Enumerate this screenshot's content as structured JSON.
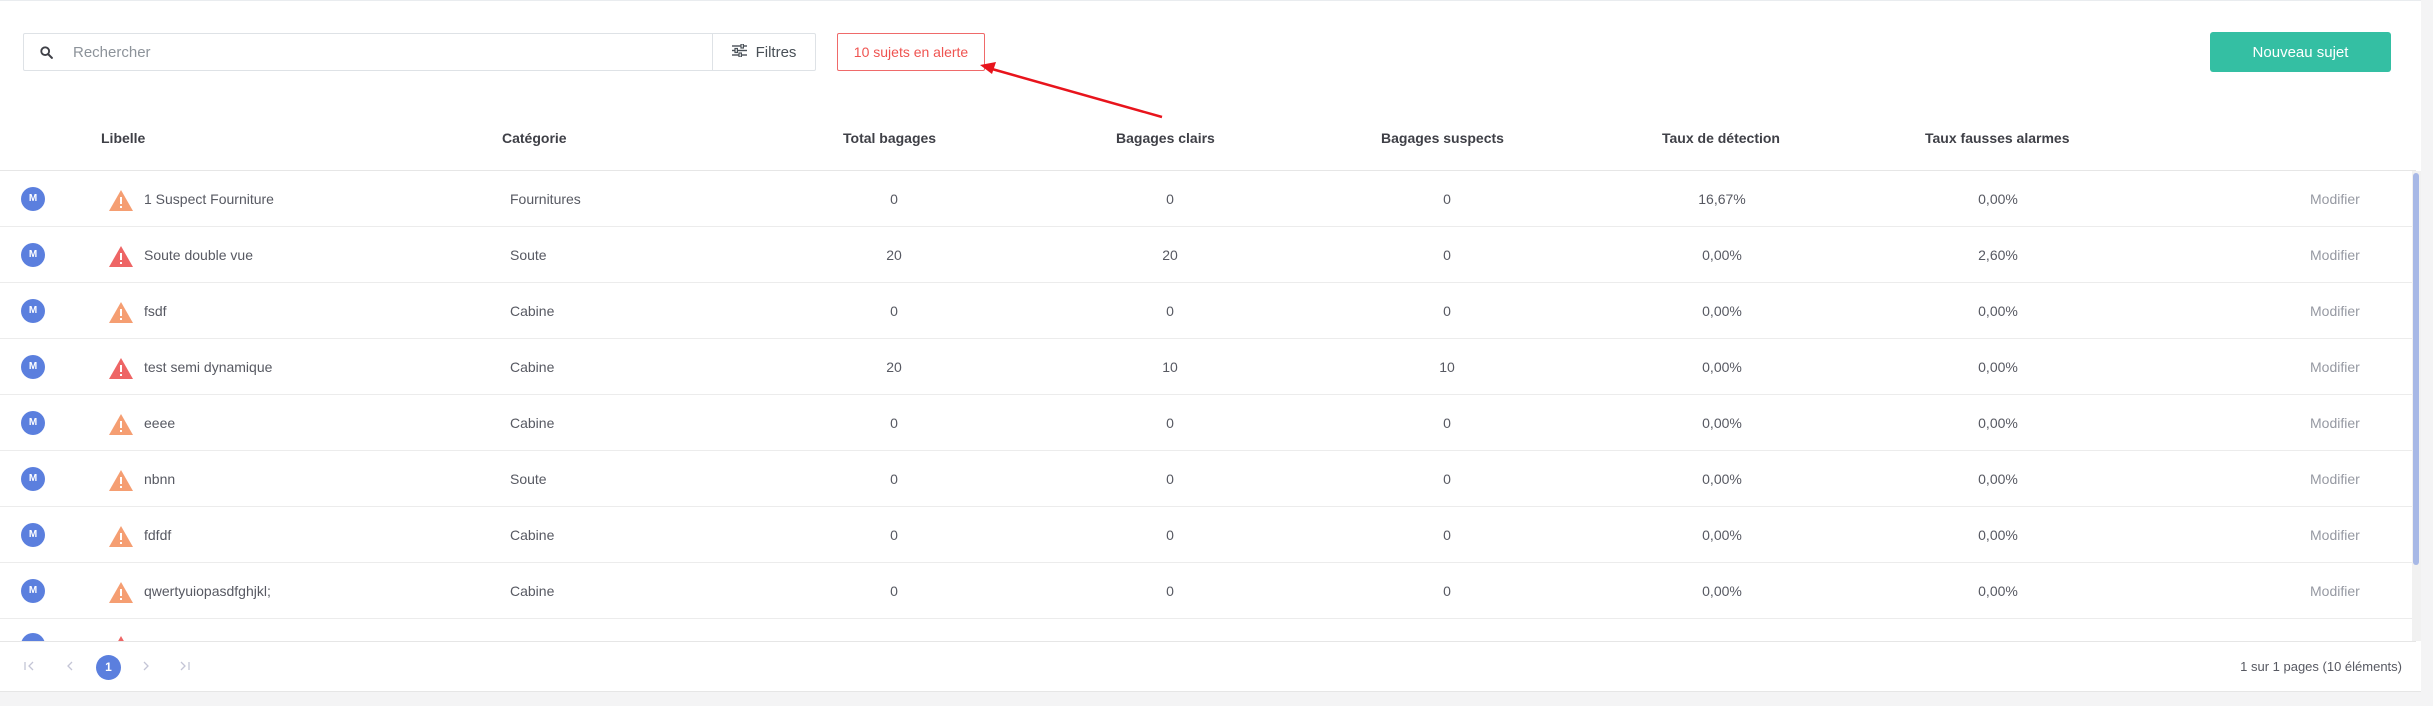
{
  "toolbar": {
    "search_placeholder": "Rechercher",
    "search_value": "",
    "filter_label": "Filtres",
    "alert_label": "10 sujets en alerte",
    "new_subject_label": "Nouveau sujet"
  },
  "table": {
    "headers": {
      "libelle": "Libelle",
      "categorie": "Catégorie",
      "total": "Total bagages",
      "clairs": "Bagages clairs",
      "suspects": "Bagages suspects",
      "taux_detection": "Taux de détection",
      "taux_fausses": "Taux fausses alarmes"
    },
    "rows": [
      {
        "avatar": "M",
        "alert_level": "warning",
        "libelle": "1 Suspect Fourniture",
        "categorie": "Fournitures",
        "total": "0",
        "clairs": "0",
        "suspects": "0",
        "taux_detection": "16,67%",
        "taux_fausses": "0,00%",
        "action": "Modifier"
      },
      {
        "avatar": "M",
        "alert_level": "danger",
        "libelle": "Soute double vue",
        "categorie": "Soute",
        "total": "20",
        "clairs": "20",
        "suspects": "0",
        "taux_detection": "0,00%",
        "taux_fausses": "2,60%",
        "action": "Modifier"
      },
      {
        "avatar": "M",
        "alert_level": "warning",
        "libelle": "fsdf",
        "categorie": "Cabine",
        "total": "0",
        "clairs": "0",
        "suspects": "0",
        "taux_detection": "0,00%",
        "taux_fausses": "0,00%",
        "action": "Modifier"
      },
      {
        "avatar": "M",
        "alert_level": "danger",
        "libelle": "test semi dynamique",
        "categorie": "Cabine",
        "total": "20",
        "clairs": "10",
        "suspects": "10",
        "taux_detection": "0,00%",
        "taux_fausses": "0,00%",
        "action": "Modifier"
      },
      {
        "avatar": "M",
        "alert_level": "warning",
        "libelle": "eeee",
        "categorie": "Cabine",
        "total": "0",
        "clairs": "0",
        "suspects": "0",
        "taux_detection": "0,00%",
        "taux_fausses": "0,00%",
        "action": "Modifier"
      },
      {
        "avatar": "M",
        "alert_level": "warning",
        "libelle": "nbnn",
        "categorie": "Soute",
        "total": "0",
        "clairs": "0",
        "suspects": "0",
        "taux_detection": "0,00%",
        "taux_fausses": "0,00%",
        "action": "Modifier"
      },
      {
        "avatar": "M",
        "alert_level": "warning",
        "libelle": "fdfdf",
        "categorie": "Cabine",
        "total": "0",
        "clairs": "0",
        "suspects": "0",
        "taux_detection": "0,00%",
        "taux_fausses": "0,00%",
        "action": "Modifier"
      },
      {
        "avatar": "M",
        "alert_level": "warning",
        "libelle": "qwertyuiopasdfghjkl;",
        "categorie": "Cabine",
        "total": "0",
        "clairs": "0",
        "suspects": "0",
        "taux_detection": "0,00%",
        "taux_fausses": "0,00%",
        "action": "Modifier"
      }
    ]
  },
  "pagination": {
    "current_page": "1",
    "info": "1 sur 1 pages (10 éléments)"
  },
  "icons": {
    "search": "search-icon",
    "filter": "sliders-icon",
    "warning": "warning-triangle-icon",
    "first": "first-page-icon",
    "prev": "prev-page-icon",
    "next": "next-page-icon",
    "last": "last-page-icon"
  },
  "colors": {
    "accent": "#34bfa3",
    "primary": "#5b7fde",
    "alert": "#ef5350",
    "warning_orange": "#f59e72",
    "danger_red": "#ee6565",
    "annotation_arrow": "#e8141c"
  }
}
